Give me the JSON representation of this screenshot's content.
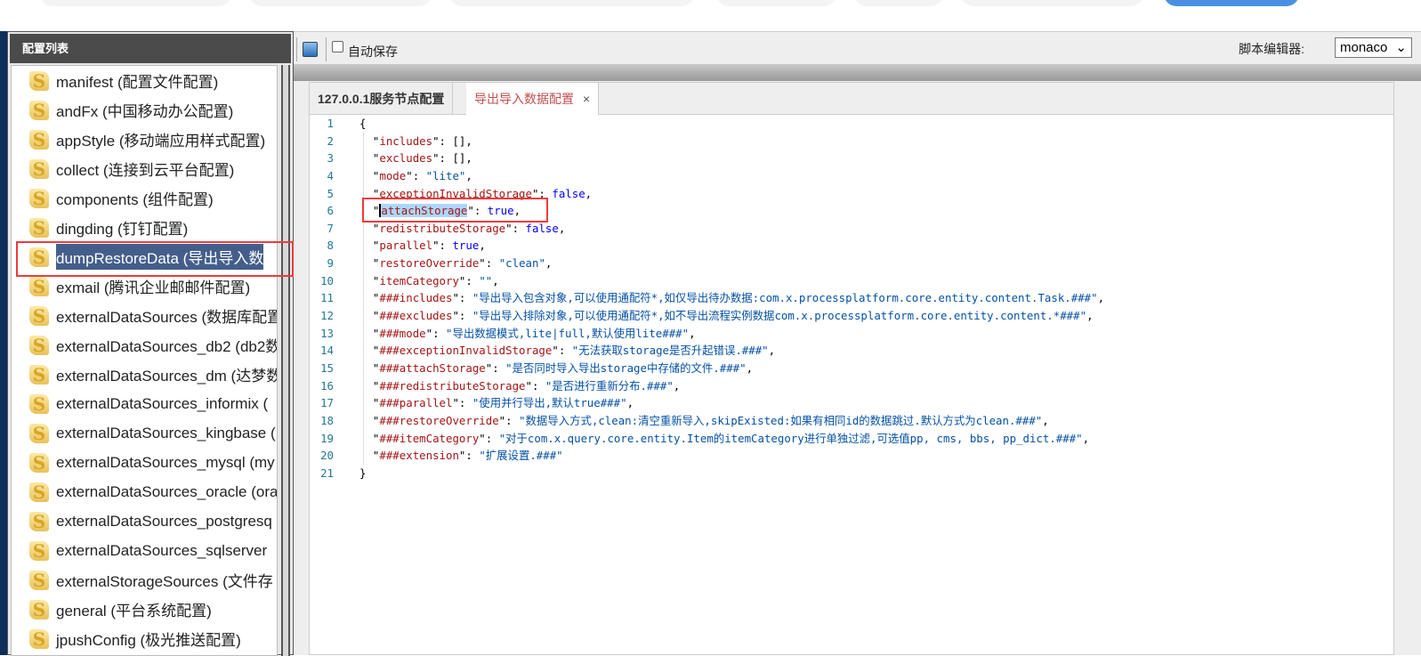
{
  "sidebar": {
    "title": "配置列表",
    "items": [
      {
        "label": "manifest (配置文件配置)"
      },
      {
        "label": "andFx (中国移动办公配置)"
      },
      {
        "label": "appStyle (移动端应用样式配置)"
      },
      {
        "label": "collect (连接到云平台配置)"
      },
      {
        "label": "components (组件配置)"
      },
      {
        "label": "dingding (钉钉配置)"
      },
      {
        "label": "dumpRestoreData (导出导入数"
      },
      {
        "label": "exmail (腾讯企业邮邮件配置)"
      },
      {
        "label": "externalDataSources (数据库配置"
      },
      {
        "label": "externalDataSources_db2 (db2数"
      },
      {
        "label": "externalDataSources_dm (达梦数"
      },
      {
        "label": "externalDataSources_informix ("
      },
      {
        "label": "externalDataSources_kingbase ("
      },
      {
        "label": "externalDataSources_mysql (my"
      },
      {
        "label": "externalDataSources_oracle (ora"
      },
      {
        "label": "externalDataSources_postgresq"
      },
      {
        "label": "externalDataSources_sqlserver"
      },
      {
        "label": "externalStorageSources (文件存"
      },
      {
        "label": "general (平台系统配置)"
      },
      {
        "label": "jpushConfig (极光推送配置)"
      }
    ],
    "selected_index": 6
  },
  "toolbar": {
    "autosave": "自动保存",
    "editor_label": "脚本编辑器:",
    "editor_value": "monaco"
  },
  "tabs": [
    {
      "label": "127.0.0.1服务节点配置"
    },
    {
      "label": "导出导入数据配置",
      "close": "×"
    }
  ],
  "code": [
    {
      "n": "1",
      "t": [
        [
          "p",
          "{"
        ]
      ]
    },
    {
      "n": "2",
      "t": [
        [
          "p",
          "  \""
        ],
        [
          "k",
          "includes"
        ],
        [
          "p",
          "\": [],"
        ]
      ]
    },
    {
      "n": "3",
      "t": [
        [
          "p",
          "  \""
        ],
        [
          "k",
          "excludes"
        ],
        [
          "p",
          "\": [],"
        ]
      ]
    },
    {
      "n": "4",
      "t": [
        [
          "p",
          "  \""
        ],
        [
          "k",
          "mode"
        ],
        [
          "p",
          "\": "
        ],
        [
          "s",
          "\"lite\""
        ],
        [
          "p",
          ","
        ]
      ]
    },
    {
      "n": "5",
      "t": [
        [
          "p",
          "  \""
        ],
        [
          "k",
          "exceptionInvalidStorage"
        ],
        [
          "p",
          "\": "
        ],
        [
          "b",
          "false"
        ],
        [
          "p",
          ","
        ]
      ]
    },
    {
      "n": "6",
      "t": [
        [
          "p",
          "  \""
        ],
        [
          "k hl cur",
          "attachStorage"
        ],
        [
          "p",
          "\": "
        ],
        [
          "b",
          "true"
        ],
        [
          "p",
          ","
        ]
      ]
    },
    {
      "n": "7",
      "t": [
        [
          "p",
          "  \""
        ],
        [
          "k",
          "redistributeStorage"
        ],
        [
          "p",
          "\": "
        ],
        [
          "b",
          "false"
        ],
        [
          "p",
          ","
        ]
      ]
    },
    {
      "n": "8",
      "t": [
        [
          "p",
          "  \""
        ],
        [
          "k",
          "parallel"
        ],
        [
          "p",
          "\": "
        ],
        [
          "b",
          "true"
        ],
        [
          "p",
          ","
        ]
      ]
    },
    {
      "n": "9",
      "t": [
        [
          "p",
          "  \""
        ],
        [
          "k",
          "restoreOverride"
        ],
        [
          "p",
          "\": "
        ],
        [
          "s",
          "\"clean\""
        ],
        [
          "p",
          ","
        ]
      ]
    },
    {
      "n": "10",
      "t": [
        [
          "p",
          "  \""
        ],
        [
          "k",
          "itemCategory"
        ],
        [
          "p",
          "\": "
        ],
        [
          "s",
          "\"\""
        ],
        [
          "p",
          ","
        ]
      ]
    },
    {
      "n": "11",
      "t": [
        [
          "p",
          "  \""
        ],
        [
          "k",
          "###includes"
        ],
        [
          "p",
          "\": "
        ],
        [
          "s",
          "\"导出导入包含对象,可以使用通配符*,如仅导出待办数据:com.x.processplatform.core.entity.content.Task.###\""
        ],
        [
          "p",
          ","
        ]
      ]
    },
    {
      "n": "12",
      "t": [
        [
          "p",
          "  \""
        ],
        [
          "k",
          "###excludes"
        ],
        [
          "p",
          "\": "
        ],
        [
          "s",
          "\"导出导入排除对象,可以使用通配符*,如不导出流程实例数据com.x.processplatform.core.entity.content.*###\""
        ],
        [
          "p",
          ","
        ]
      ]
    },
    {
      "n": "13",
      "t": [
        [
          "p",
          "  \""
        ],
        [
          "k",
          "###mode"
        ],
        [
          "p",
          "\": "
        ],
        [
          "s",
          "\"导出数据模式,lite|full,默认使用lite###\""
        ],
        [
          "p",
          ","
        ]
      ]
    },
    {
      "n": "14",
      "t": [
        [
          "p",
          "  \""
        ],
        [
          "k",
          "###exceptionInvalidStorage"
        ],
        [
          "p",
          "\": "
        ],
        [
          "s",
          "\"无法获取storage是否升起错误.###\""
        ],
        [
          "p",
          ","
        ]
      ]
    },
    {
      "n": "15",
      "t": [
        [
          "p",
          "  \""
        ],
        [
          "k",
          "###attachStorage"
        ],
        [
          "p",
          "\": "
        ],
        [
          "s",
          "\"是否同时导入导出storage中存储的文件.###\""
        ],
        [
          "p",
          ","
        ]
      ]
    },
    {
      "n": "16",
      "t": [
        [
          "p",
          "  \""
        ],
        [
          "k",
          "###redistributeStorage"
        ],
        [
          "p",
          "\": "
        ],
        [
          "s",
          "\"是否进行重新分布.###\""
        ],
        [
          "p",
          ","
        ]
      ]
    },
    {
      "n": "17",
      "t": [
        [
          "p",
          "  \""
        ],
        [
          "k",
          "###parallel"
        ],
        [
          "p",
          "\": "
        ],
        [
          "s",
          "\"使用并行导出,默认true###\""
        ],
        [
          "p",
          ","
        ]
      ]
    },
    {
      "n": "18",
      "t": [
        [
          "p",
          "  \""
        ],
        [
          "k",
          "###restoreOverride"
        ],
        [
          "p",
          "\": "
        ],
        [
          "s",
          "\"数据导入方式,clean:清空重新导入,skipExisted:如果有相同id的数据跳过.默认方式为clean.###\""
        ],
        [
          "p",
          ","
        ]
      ]
    },
    {
      "n": "19",
      "t": [
        [
          "p",
          "  \""
        ],
        [
          "k",
          "###itemCategory"
        ],
        [
          "p",
          "\": "
        ],
        [
          "s",
          "\"对于com.x.query.core.entity.Item的itemCategory进行单独过滤,可选值pp, cms, bbs, pp_dict.###\""
        ],
        [
          "p",
          ","
        ]
      ]
    },
    {
      "n": "20",
      "t": [
        [
          "p",
          "  \""
        ],
        [
          "k",
          "###extension"
        ],
        [
          "p",
          "\": "
        ],
        [
          "s",
          "\"扩展设置.###\""
        ]
      ]
    },
    {
      "n": "21",
      "t": [
        [
          "p",
          "}"
        ]
      ]
    }
  ]
}
